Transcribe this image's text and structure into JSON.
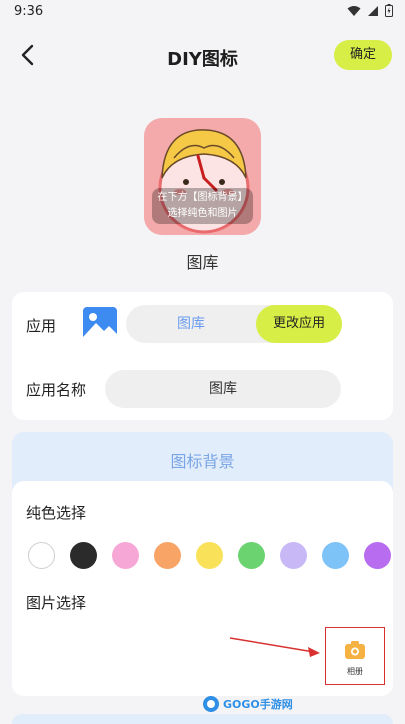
{
  "status_bar": {
    "time": "9:36"
  },
  "header": {
    "title": "DIY图标",
    "confirm_label": "确定"
  },
  "preview": {
    "caption_line1": "在下方【图标背景】",
    "caption_line2": "选择纯色和图片",
    "app_name": "图库"
  },
  "app_row": {
    "label": "应用",
    "current_app": "图库",
    "change_label": "更改应用"
  },
  "name_row": {
    "label": "应用名称",
    "value": "图库"
  },
  "background_section": {
    "title": "图标背景",
    "solid_label": "纯色选择",
    "colors": [
      "#ffffff",
      "#2b2b2b",
      "#f7a7d6",
      "#f8a466",
      "#f9e25a",
      "#6bd36f",
      "#c8b8f5",
      "#7ec3f7",
      "#b86cf0"
    ],
    "image_label": "图片选择",
    "album_label": "相册"
  },
  "watermark": {
    "text": "GOGO手游网"
  }
}
